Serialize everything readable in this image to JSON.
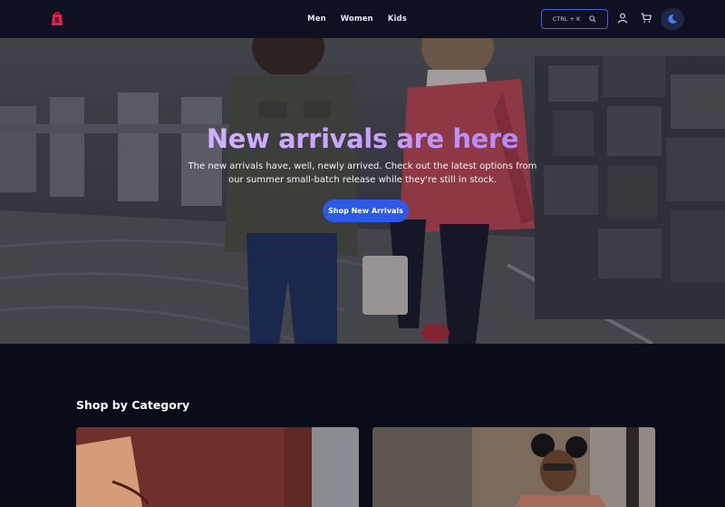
{
  "header": {
    "nav": [
      "Men",
      "Women",
      "Kids"
    ],
    "search_shortcut": "CTRL + K",
    "icons": {
      "logo": "shopping-bag-logo",
      "search": "search-icon",
      "account": "user-icon",
      "cart": "cart-icon",
      "theme": "theme-toggle-icon"
    }
  },
  "hero": {
    "title": "New arrivals are here",
    "subtitle": "The new arrivals have, well, newly arrived. Check out the latest options from our summer small-batch release while they're still in stock.",
    "cta": "Shop New Arrivals"
  },
  "categories": {
    "title": "Shop by Category"
  },
  "colors": {
    "page_bg": "#0b0c1a",
    "header_bg": "#0f1022",
    "accent": "#2d59e6",
    "logo": "#e3224a",
    "title_gradient_start": "#dcc6ff",
    "title_gradient_end": "#9b63ec"
  }
}
